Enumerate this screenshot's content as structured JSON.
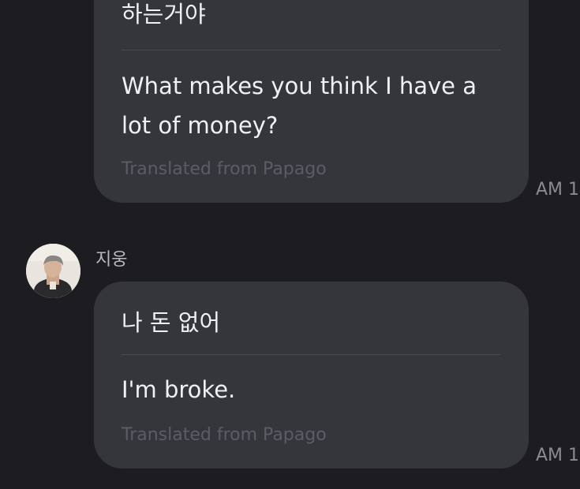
{
  "messages": [
    {
      "original": "하는거야",
      "translation": "What makes you think I have a lot of money?",
      "credit": "Translated from Papago",
      "time": "AM 1"
    },
    {
      "sender": "지웅",
      "avatar_icon": "user-avatar-photo",
      "original": "나 돈 없어",
      "translation": "I'm broke.",
      "credit": "Translated from Papago",
      "time": "AM 1"
    }
  ],
  "colors": {
    "background": "#1d1d21",
    "bubble": "#35363c",
    "text": "#f0f0f2",
    "credit": "#5c5d64",
    "timestamp": "#8a8b91"
  }
}
